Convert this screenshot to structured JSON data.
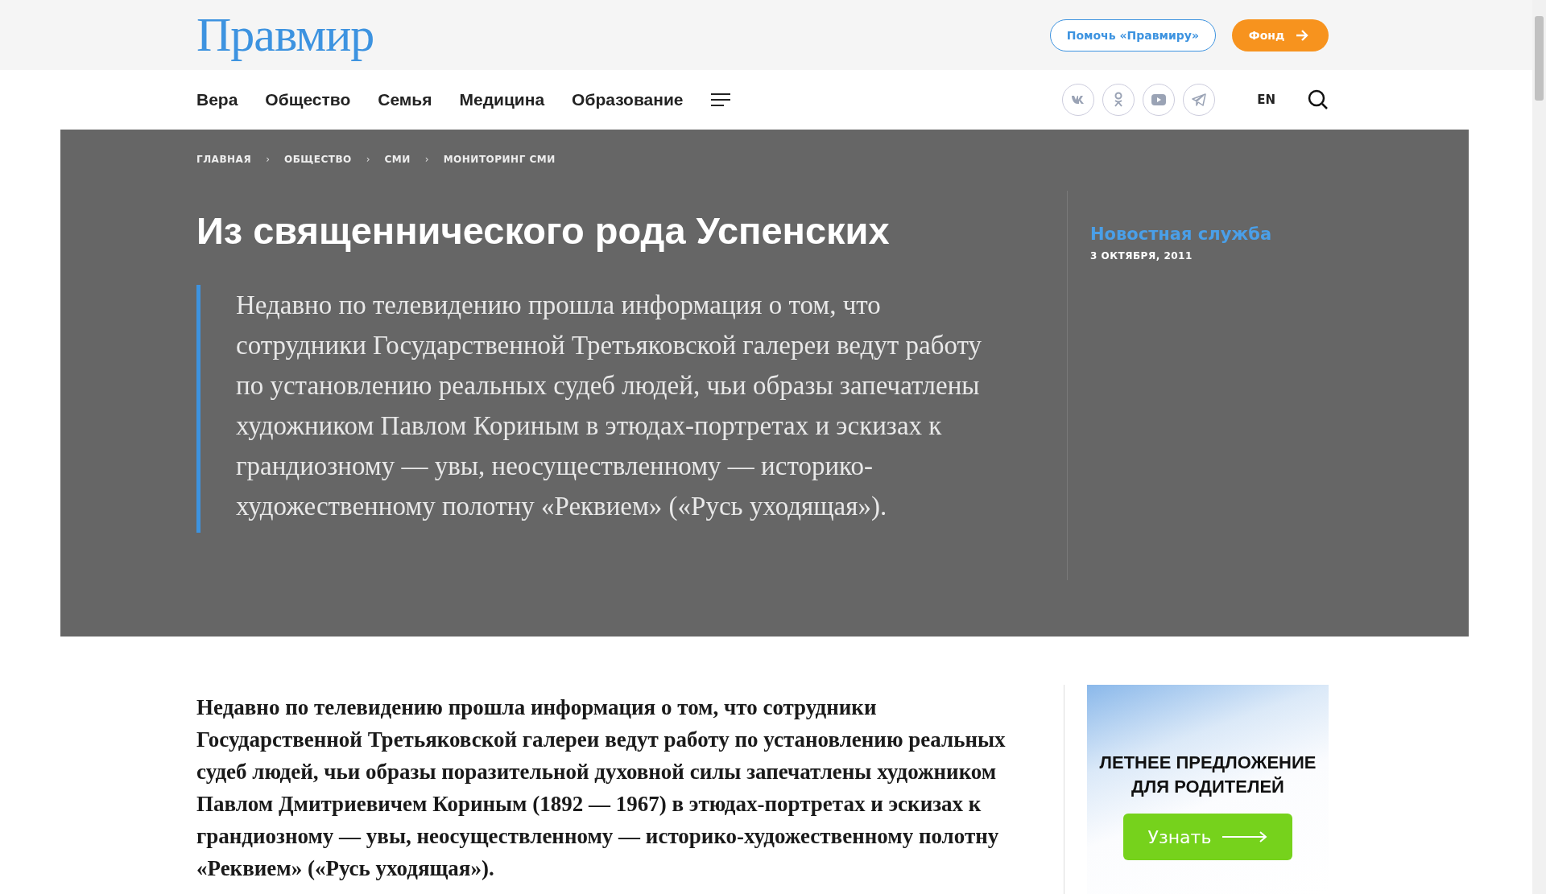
{
  "header": {
    "logo": "Правмир",
    "buttons": [
      {
        "label": "Помочь «Правмиру»",
        "kind": "outline"
      },
      {
        "label": "Фонд",
        "kind": "filled"
      }
    ]
  },
  "nav": {
    "items": [
      "Вера",
      "Общество",
      "Семья",
      "Медицина",
      "Образование"
    ],
    "socials": [
      {
        "kind": "vk"
      },
      {
        "kind": "ok"
      },
      {
        "kind": "youtube"
      },
      {
        "kind": "telegram"
      }
    ],
    "language": "EN"
  },
  "breadcrumbs": [
    "ГЛАВНАЯ",
    "ОБЩЕСТВО",
    "СМИ",
    "МОНИТОРИНГ СМИ"
  ],
  "breadcrumb_separator": "›",
  "article": {
    "title": "Из священнического рода Успенских",
    "lead": "Недавно по телевидению прошла информация о том, что сотрудники Государственной Третьяковской галереи ведут работу по установлению реальных судеб людей, чьи образы запечатлены художником Павлом Кориным в этюдах-портретах и эскизах к грандиозному — увы, неосуществленному — историко-художественному полотну «Реквием» («Русь уходящая»).",
    "author": "Новостная служба",
    "date": "3 ОКТЯБРЯ, 2011",
    "body": "Недавно по телевидению прошла информация о том, что сотрудники Государственной Третьяковской галереи ведут работу по установлению реальных судеб людей, чьи образы поразительной духовной силы запечатлены художником Павлом Дмитриевичем Кориным (1892 — 1967) в этюдах-портретах и эскизах к грандиозному — увы, неосуществленному — историко-художественному полотну «Реквием» («Русь уходящая»)."
  },
  "ad": {
    "title": "ЛЕТНЕЕ ПРЕДЛОЖЕНИЕ ДЛЯ РОДИТЕЛЕЙ",
    "button": "Узнать"
  }
}
